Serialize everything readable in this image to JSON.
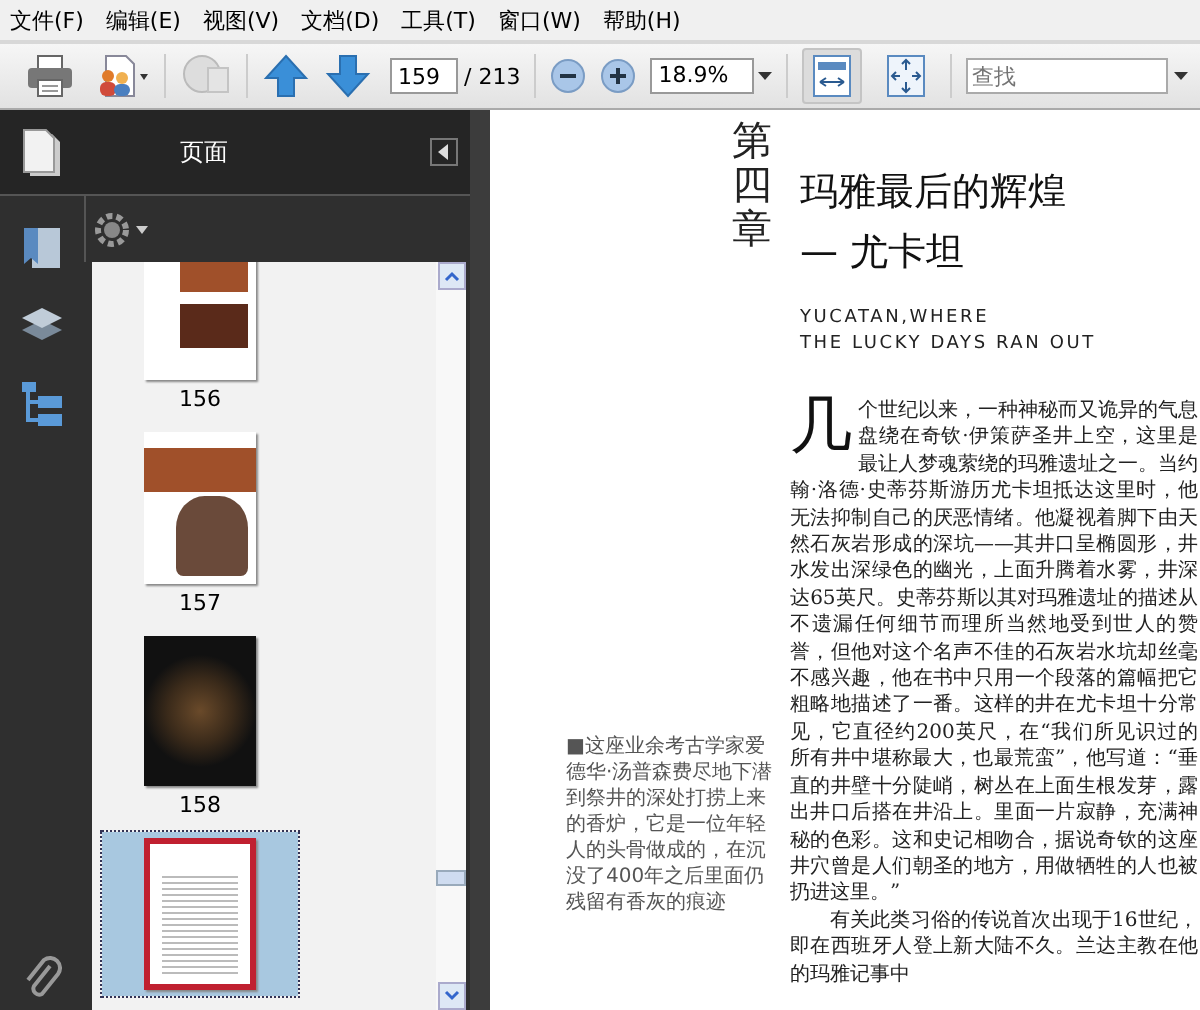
{
  "menu": [
    "文件(F)",
    "编辑(E)",
    "视图(V)",
    "文档(D)",
    "工具(T)",
    "窗口(W)",
    "帮助(H)"
  ],
  "toolbar": {
    "page_number": "159",
    "page_total": "/ 213",
    "zoom": "18.9%",
    "search": {
      "placeholder": "查找"
    },
    "view_buttons": [
      {
        "kind": "fit-width",
        "selected": true
      },
      {
        "kind": "fit-page",
        "selected": false
      }
    ]
  },
  "sidebar": {
    "panel_title": "页面",
    "thumbnails": [
      {
        "kind": "text-photos",
        "label": "156",
        "selected": false
      },
      {
        "kind": "photo-figure",
        "label": "157",
        "selected": false
      },
      {
        "kind": "dark-photo",
        "label": "158",
        "selected": false
      },
      {
        "kind": "chapter-page",
        "selected": true
      }
    ]
  },
  "document": {
    "chapter_marker": "第四章",
    "title_lines": [
      "玛雅最后的辉煌",
      "— 尤卡坦"
    ],
    "subtitle_lines": [
      "YUCATAN,WHERE",
      "THE LUCKY DAYS RAN OUT"
    ],
    "caption": "■这座业余考古学家爱德华·汤普森费尽地下潜到祭井的深处打捞上来的香炉，它是一位年轻人的头骨做成的，在沉没了400年之后里面仍残留有香灰的痕迹",
    "drop_cap": "几",
    "paragraphs": [
      "个世纪以来，一种神秘而又诡异的气息盘绕在奇钦·伊策萨圣井上空，这里是最让人梦魂萦绕的玛雅遗址之一。当约翰·洛德·史蒂芬斯游历尤卡坦抵达这里时，他无法抑制自己的厌恶情绪。他凝视着脚下由天然石灰岩形成的深坑——其井口呈椭圆形，井水发出深绿色的幽光，上面升腾着水雾，井深达65英尺。史蒂芬斯以其对玛雅遗址的描述从不遗漏任何细节而理所当然地受到世人的赞誉，但他对这个名声不佳的石灰岩水坑却丝毫不感兴趣，他在书中只用一个段落的篇幅把它粗略地描述了一番。这样的井在尤卡坦十分常见，它直径约200英尺，在“我们所见识过的所有井中堪称最大，也最荒蛮”，他写道：“垂直的井壁十分陡峭，树丛在上面生根发芽，露出井口后搭在井沿上。里面一片寂静，充满神秘的色彩。这和史记相吻合，据说奇钦的这座井穴曾是人们朝圣的地方，用做牺牲的人也被扔进这里。”",
      "有关此类习俗的传说首次出现于16世纪，即在西班牙人登上新大陆不久。兰达主教在他的玛雅记事中"
    ]
  }
}
